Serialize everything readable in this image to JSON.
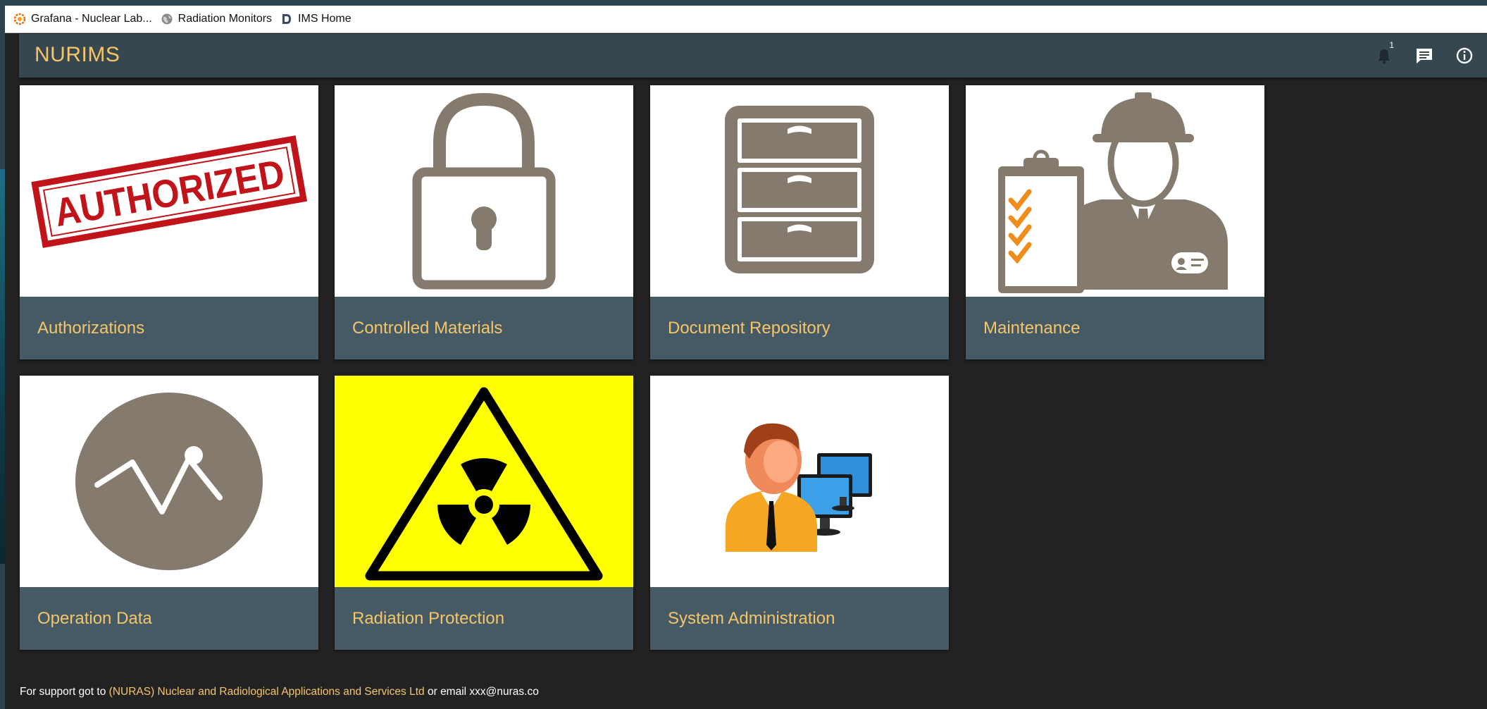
{
  "bookmarks": [
    {
      "label": "Grafana - Nuclear Lab...",
      "icon": "grafana-icon"
    },
    {
      "label": "Radiation Monitors",
      "icon": "globe-icon"
    },
    {
      "label": "IMS Home",
      "icon": "dokuwiki-icon"
    }
  ],
  "app": {
    "title": "NURIMS",
    "notification_count": "1",
    "accent_color": "#f5c56a",
    "bar_color": "#37474f"
  },
  "tiles": [
    {
      "label": "Authorizations",
      "stamp_text": "AUTHORIZED",
      "icon": "authorized-stamp-icon"
    },
    {
      "label": "Controlled Materials",
      "icon": "padlock-icon"
    },
    {
      "label": "Document Repository",
      "icon": "filing-cabinet-icon"
    },
    {
      "label": "Maintenance",
      "icon": "engineer-checklist-icon"
    },
    {
      "label": "Operation Data",
      "icon": "line-graph-icon"
    },
    {
      "label": "Radiation Protection",
      "icon": "radiation-warning-icon"
    },
    {
      "label": "System Administration",
      "icon": "administrator-icon"
    }
  ],
  "footer": {
    "prefix": "For support got to ",
    "org_link": "(NURAS) Nuclear and Radiological Applications and Services Ltd",
    "email_text": " or email xxx@nuras.co"
  }
}
